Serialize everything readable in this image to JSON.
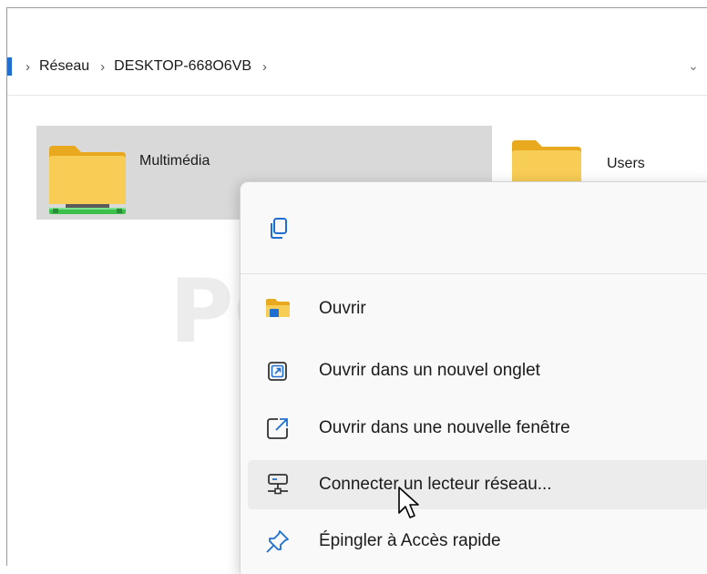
{
  "addressbar": {
    "crumbs": [
      "Réseau",
      "DESKTOP-668O6VB"
    ],
    "separator": "›",
    "dropdown": "⌄"
  },
  "folders": [
    {
      "name": "Multimédia",
      "selected": true,
      "icon": "network-folder-icon"
    },
    {
      "name": "Users",
      "selected": false,
      "icon": "folder-icon"
    }
  ],
  "context_menu": {
    "top_actions": [
      {
        "icon": "copy-icon"
      }
    ],
    "items": [
      {
        "label": "Ouvrir",
        "icon": "folder-open-icon"
      },
      {
        "label": "Ouvrir dans un nouvel onglet",
        "icon": "new-tab-icon"
      },
      {
        "label": "Ouvrir dans une nouvelle fenêtre",
        "icon": "new-window-icon"
      },
      {
        "label": "Connecter un lecteur réseau...",
        "icon": "map-network-drive-icon",
        "hover": true
      },
      {
        "label": "Épingler à Accès rapide",
        "icon": "pin-icon"
      }
    ]
  },
  "watermark": {
    "text": "PCASTUCES"
  },
  "colors": {
    "accent": "#1f6fd1",
    "folder_yellow": "#f7c948",
    "network_green": "#3cc04b",
    "selection": "#d9d9d9"
  }
}
